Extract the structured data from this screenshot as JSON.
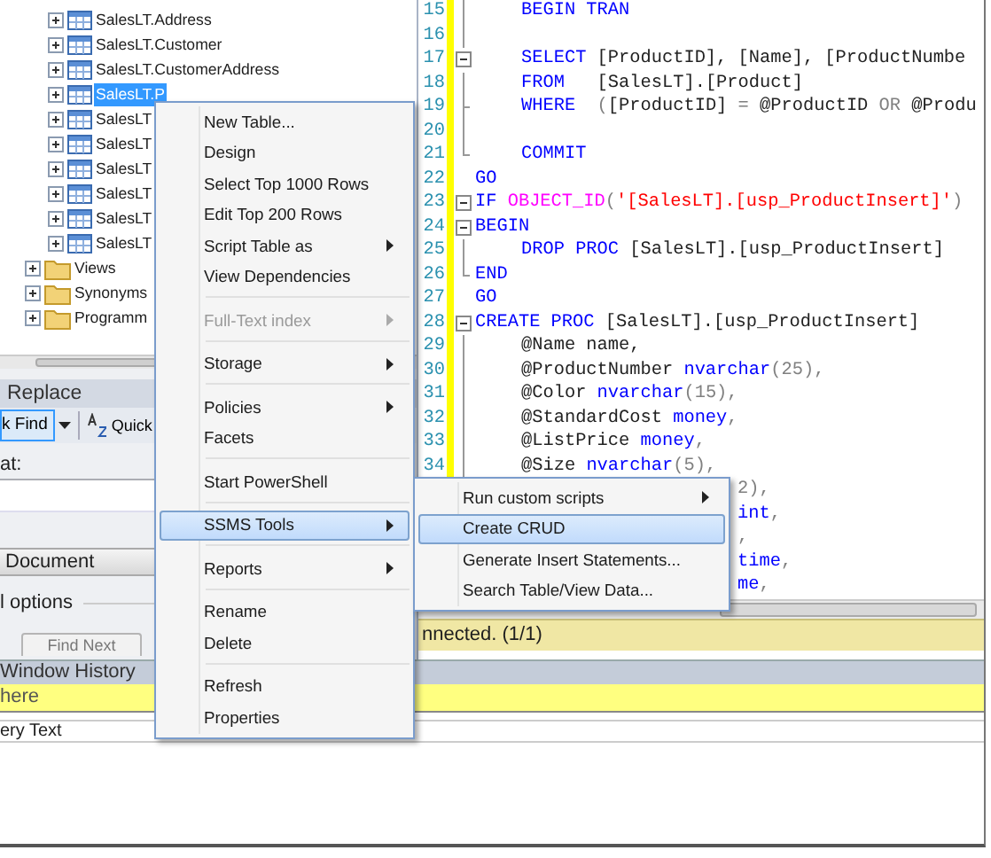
{
  "object_explorer": {
    "items": [
      {
        "label": "SalesLT.Address",
        "kind": "table",
        "selected": false
      },
      {
        "label": "SalesLT.Customer",
        "kind": "table",
        "selected": false
      },
      {
        "label": "SalesLT.CustomerAddress",
        "kind": "table",
        "selected": false
      },
      {
        "label": "SalesLT.P",
        "kind": "table",
        "selected": true
      },
      {
        "label": "SalesLT",
        "kind": "table",
        "selected": false
      },
      {
        "label": "SalesLT",
        "kind": "table",
        "selected": false
      },
      {
        "label": "SalesLT",
        "kind": "table",
        "selected": false
      },
      {
        "label": "SalesLT",
        "kind": "table",
        "selected": false
      },
      {
        "label": "SalesLT",
        "kind": "table",
        "selected": false
      },
      {
        "label": "SalesLT",
        "kind": "table",
        "selected": false
      },
      {
        "label": "Views",
        "kind": "folder",
        "selected": false
      },
      {
        "label": "Synonyms",
        "kind": "folder",
        "selected": false
      },
      {
        "label": "Programm",
        "kind": "folder",
        "selected": false
      }
    ]
  },
  "find_replace": {
    "title": "Replace",
    "quick_find": "k Find",
    "quick_replace": "Quick",
    "find_what_label": "at:",
    "look_in": "Document",
    "options": "l options",
    "find_next": "Find Next"
  },
  "editor": {
    "lines": [
      {
        "number": "15",
        "kind": "line",
        "indented": true,
        "covered": false,
        "tokens": [
          {
            "kind": "kw",
            "text": "BEGIN TRAN"
          }
        ]
      },
      {
        "number": "16",
        "kind": "line",
        "covered": false
      },
      {
        "number": "17",
        "kind": "start",
        "indented": true,
        "covered": false,
        "tokens": [
          {
            "kind": "kw",
            "text": "SELECT"
          },
          {
            "kind": "plain",
            "text": " [ProductID], [Name], [ProductNumbe"
          }
        ]
      },
      {
        "number": "18",
        "kind": "line",
        "indented": true,
        "covered": false,
        "tokens": [
          {
            "kind": "kw",
            "text": "FROM"
          },
          {
            "kind": "plain",
            "text": "   [SalesLT].[Product]"
          }
        ]
      },
      {
        "number": "19",
        "kind": "tick",
        "indented": true,
        "covered": false,
        "tokens": [
          {
            "kind": "kw",
            "text": "WHERE"
          },
          {
            "kind": "gray",
            "text": "  ("
          },
          {
            "kind": "plain",
            "text": "[ProductID] "
          },
          {
            "kind": "gray",
            "text": "="
          },
          {
            "kind": "plain",
            "text": " @ProductID "
          },
          {
            "kind": "gray",
            "text": "OR"
          },
          {
            "kind": "plain",
            "text": " @Produ"
          }
        ]
      },
      {
        "number": "20",
        "kind": "line",
        "covered": false
      },
      {
        "number": "21",
        "kind": "end",
        "indented": true,
        "covered": false,
        "tokens": [
          {
            "kind": "kw",
            "text": "COMMIT"
          }
        ]
      },
      {
        "number": "22",
        "kind": "plain",
        "indented": false,
        "covered": false,
        "tokens": [
          {
            "kind": "kw",
            "text": "GO"
          }
        ]
      },
      {
        "number": "23",
        "kind": "start",
        "indented": false,
        "covered": false,
        "tokens": [
          {
            "kind": "kw",
            "text": "IF "
          },
          {
            "kind": "fn",
            "text": "OBJECT_ID"
          },
          {
            "kind": "gray",
            "text": "("
          },
          {
            "kind": "str",
            "text": "'[SalesLT].[usp_ProductInsert]'"
          },
          {
            "kind": "gray",
            "text": ")"
          }
        ]
      },
      {
        "number": "24",
        "kind": "start",
        "indented": false,
        "covered": false,
        "tokens": [
          {
            "kind": "kw",
            "text": "BEGIN"
          }
        ]
      },
      {
        "number": "25",
        "kind": "line",
        "indented": true,
        "covered": false,
        "tokens": [
          {
            "kind": "kw",
            "text": "DROP PROC"
          },
          {
            "kind": "plain",
            "text": " [SalesLT].[usp_ProductInsert]"
          }
        ]
      },
      {
        "number": "26",
        "kind": "end",
        "indented": false,
        "covered": false,
        "tokens": [
          {
            "kind": "kw",
            "text": "END"
          }
        ]
      },
      {
        "number": "27",
        "kind": "plain",
        "indented": false,
        "covered": false,
        "tokens": [
          {
            "kind": "kw",
            "text": "GO"
          }
        ]
      },
      {
        "number": "28",
        "kind": "start",
        "indented": false,
        "covered": false,
        "tokens": [
          {
            "kind": "kw",
            "text": "CREATE PROC"
          },
          {
            "kind": "plain",
            "text": " [SalesLT].[usp_ProductInsert]"
          }
        ]
      },
      {
        "number": "29",
        "kind": "line",
        "indented": true,
        "covered": false,
        "tokens": [
          {
            "kind": "plain",
            "text": "@Name name,"
          }
        ]
      },
      {
        "number": "30",
        "kind": "line",
        "indented": true,
        "covered": false,
        "tokens": [
          {
            "kind": "plain",
            "text": "@ProductNumber "
          },
          {
            "kind": "kw",
            "text": "nvarchar"
          },
          {
            "kind": "gray",
            "text": "(25),"
          }
        ]
      },
      {
        "number": "31",
        "kind": "line",
        "indented": true,
        "covered": false,
        "tokens": [
          {
            "kind": "plain",
            "text": "@Color "
          },
          {
            "kind": "kw",
            "text": "nvarchar"
          },
          {
            "kind": "gray",
            "text": "(15),"
          }
        ]
      },
      {
        "number": "32",
        "kind": "line",
        "indented": true,
        "covered": false,
        "tokens": [
          {
            "kind": "plain",
            "text": "@StandardCost "
          },
          {
            "kind": "kw",
            "text": "money"
          },
          {
            "kind": "gray",
            "text": ","
          }
        ]
      },
      {
        "number": "33",
        "kind": "line",
        "indented": true,
        "covered": false,
        "tokens": [
          {
            "kind": "plain",
            "text": "@ListPrice "
          },
          {
            "kind": "kw",
            "text": "money"
          },
          {
            "kind": "gray",
            "text": ","
          }
        ]
      },
      {
        "number": "34",
        "kind": "line",
        "indented": true,
        "covered": false,
        "tokens": [
          {
            "kind": "plain",
            "text": "@Size "
          },
          {
            "kind": "kw",
            "text": "nvarchar"
          },
          {
            "kind": "gray",
            "text": "(5),"
          }
        ]
      },
      {
        "covered": true,
        "tokens": [
          {
            "kind": "gray",
            "text": "2),"
          }
        ]
      },
      {
        "covered": true,
        "tokens": [
          {
            "kind": "kw",
            "text": "int"
          },
          {
            "kind": "gray",
            "text": ","
          }
        ]
      },
      {
        "covered": true,
        "tokens": [
          {
            "kind": "gray",
            "text": ","
          }
        ]
      },
      {
        "covered": true,
        "tokens": [
          {
            "kind": "kw",
            "text": "time"
          },
          {
            "kind": "gray",
            "text": ","
          }
        ]
      },
      {
        "covered": true,
        "tokens": [
          {
            "kind": "kw",
            "text": "me"
          },
          {
            "kind": "gray",
            "text": ","
          }
        ]
      }
    ],
    "status": "nnected. (1/1)"
  },
  "bottom": {
    "window_history": "Window History",
    "info_bar": "here",
    "column_header": "ery Text"
  },
  "context_menu": {
    "items": [
      {
        "kind": "item",
        "label": "New Table...",
        "submenu": false,
        "disabled": false,
        "selected": false
      },
      {
        "kind": "item",
        "label": "Design",
        "submenu": false,
        "disabled": false,
        "selected": false
      },
      {
        "kind": "item",
        "label": "Select Top 1000 Rows",
        "submenu": false,
        "disabled": false,
        "selected": false
      },
      {
        "kind": "item",
        "label": "Edit Top 200 Rows",
        "submenu": false,
        "disabled": false,
        "selected": false
      },
      {
        "kind": "item",
        "label": "Script Table as",
        "submenu": true,
        "disabled": false,
        "selected": false
      },
      {
        "kind": "item",
        "label": "View Dependencies",
        "submenu": false,
        "disabled": false,
        "selected": false
      },
      {
        "kind": "separator"
      },
      {
        "kind": "item",
        "label": "Full-Text index",
        "submenu": true,
        "disabled": true,
        "selected": false
      },
      {
        "kind": "separator"
      },
      {
        "kind": "item",
        "label": "Storage",
        "submenu": true,
        "disabled": false,
        "selected": false
      },
      {
        "kind": "separator"
      },
      {
        "kind": "item",
        "label": "Policies",
        "submenu": true,
        "disabled": false,
        "selected": false
      },
      {
        "kind": "item",
        "label": "Facets",
        "submenu": false,
        "disabled": false,
        "selected": false
      },
      {
        "kind": "separator"
      },
      {
        "kind": "item",
        "label": "Start PowerShell",
        "submenu": false,
        "disabled": false,
        "selected": false
      },
      {
        "kind": "separator"
      },
      {
        "kind": "item",
        "label": "SSMS Tools",
        "submenu": true,
        "disabled": false,
        "selected": true
      },
      {
        "kind": "separator"
      },
      {
        "kind": "item",
        "label": "Reports",
        "submenu": true,
        "disabled": false,
        "selected": false
      },
      {
        "kind": "separator"
      },
      {
        "kind": "item",
        "label": "Rename",
        "submenu": false,
        "disabled": false,
        "selected": false
      },
      {
        "kind": "item",
        "label": "Delete",
        "submenu": false,
        "disabled": false,
        "selected": false
      },
      {
        "kind": "separator"
      },
      {
        "kind": "item",
        "label": "Refresh",
        "submenu": false,
        "disabled": false,
        "selected": false
      },
      {
        "kind": "item",
        "label": "Properties",
        "submenu": false,
        "disabled": false,
        "selected": false
      }
    ]
  },
  "submenu": {
    "items": [
      {
        "kind": "item",
        "label": "Run custom scripts",
        "submenu": true,
        "disabled": false,
        "selected": false
      },
      {
        "kind": "item",
        "label": "Create CRUD",
        "submenu": false,
        "disabled": false,
        "selected": true
      },
      {
        "kind": "item",
        "label": "Generate Insert Statements...",
        "submenu": false,
        "disabled": false,
        "selected": false
      },
      {
        "kind": "item",
        "label": "Search Table/View Data...",
        "submenu": false,
        "disabled": false,
        "selected": false
      }
    ]
  }
}
